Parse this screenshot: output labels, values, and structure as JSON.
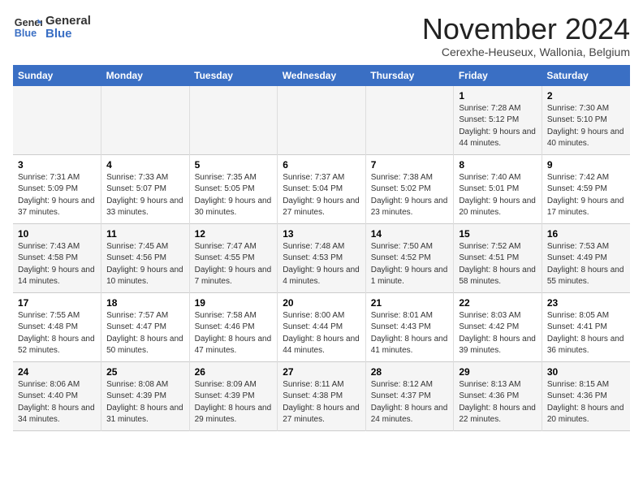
{
  "logo": {
    "line1": "General",
    "line2": "Blue"
  },
  "title": "November 2024",
  "subtitle": "Cerexhe-Heuseux, Wallonia, Belgium",
  "headers": [
    "Sunday",
    "Monday",
    "Tuesday",
    "Wednesday",
    "Thursday",
    "Friday",
    "Saturday"
  ],
  "weeks": [
    [
      {
        "day": "",
        "info": ""
      },
      {
        "day": "",
        "info": ""
      },
      {
        "day": "",
        "info": ""
      },
      {
        "day": "",
        "info": ""
      },
      {
        "day": "",
        "info": ""
      },
      {
        "day": "1",
        "info": "Sunrise: 7:28 AM\nSunset: 5:12 PM\nDaylight: 9 hours and 44 minutes."
      },
      {
        "day": "2",
        "info": "Sunrise: 7:30 AM\nSunset: 5:10 PM\nDaylight: 9 hours and 40 minutes."
      }
    ],
    [
      {
        "day": "3",
        "info": "Sunrise: 7:31 AM\nSunset: 5:09 PM\nDaylight: 9 hours and 37 minutes."
      },
      {
        "day": "4",
        "info": "Sunrise: 7:33 AM\nSunset: 5:07 PM\nDaylight: 9 hours and 33 minutes."
      },
      {
        "day": "5",
        "info": "Sunrise: 7:35 AM\nSunset: 5:05 PM\nDaylight: 9 hours and 30 minutes."
      },
      {
        "day": "6",
        "info": "Sunrise: 7:37 AM\nSunset: 5:04 PM\nDaylight: 9 hours and 27 minutes."
      },
      {
        "day": "7",
        "info": "Sunrise: 7:38 AM\nSunset: 5:02 PM\nDaylight: 9 hours and 23 minutes."
      },
      {
        "day": "8",
        "info": "Sunrise: 7:40 AM\nSunset: 5:01 PM\nDaylight: 9 hours and 20 minutes."
      },
      {
        "day": "9",
        "info": "Sunrise: 7:42 AM\nSunset: 4:59 PM\nDaylight: 9 hours and 17 minutes."
      }
    ],
    [
      {
        "day": "10",
        "info": "Sunrise: 7:43 AM\nSunset: 4:58 PM\nDaylight: 9 hours and 14 minutes."
      },
      {
        "day": "11",
        "info": "Sunrise: 7:45 AM\nSunset: 4:56 PM\nDaylight: 9 hours and 10 minutes."
      },
      {
        "day": "12",
        "info": "Sunrise: 7:47 AM\nSunset: 4:55 PM\nDaylight: 9 hours and 7 minutes."
      },
      {
        "day": "13",
        "info": "Sunrise: 7:48 AM\nSunset: 4:53 PM\nDaylight: 9 hours and 4 minutes."
      },
      {
        "day": "14",
        "info": "Sunrise: 7:50 AM\nSunset: 4:52 PM\nDaylight: 9 hours and 1 minute."
      },
      {
        "day": "15",
        "info": "Sunrise: 7:52 AM\nSunset: 4:51 PM\nDaylight: 8 hours and 58 minutes."
      },
      {
        "day": "16",
        "info": "Sunrise: 7:53 AM\nSunset: 4:49 PM\nDaylight: 8 hours and 55 minutes."
      }
    ],
    [
      {
        "day": "17",
        "info": "Sunrise: 7:55 AM\nSunset: 4:48 PM\nDaylight: 8 hours and 52 minutes."
      },
      {
        "day": "18",
        "info": "Sunrise: 7:57 AM\nSunset: 4:47 PM\nDaylight: 8 hours and 50 minutes."
      },
      {
        "day": "19",
        "info": "Sunrise: 7:58 AM\nSunset: 4:46 PM\nDaylight: 8 hours and 47 minutes."
      },
      {
        "day": "20",
        "info": "Sunrise: 8:00 AM\nSunset: 4:44 PM\nDaylight: 8 hours and 44 minutes."
      },
      {
        "day": "21",
        "info": "Sunrise: 8:01 AM\nSunset: 4:43 PM\nDaylight: 8 hours and 41 minutes."
      },
      {
        "day": "22",
        "info": "Sunrise: 8:03 AM\nSunset: 4:42 PM\nDaylight: 8 hours and 39 minutes."
      },
      {
        "day": "23",
        "info": "Sunrise: 8:05 AM\nSunset: 4:41 PM\nDaylight: 8 hours and 36 minutes."
      }
    ],
    [
      {
        "day": "24",
        "info": "Sunrise: 8:06 AM\nSunset: 4:40 PM\nDaylight: 8 hours and 34 minutes."
      },
      {
        "day": "25",
        "info": "Sunrise: 8:08 AM\nSunset: 4:39 PM\nDaylight: 8 hours and 31 minutes."
      },
      {
        "day": "26",
        "info": "Sunrise: 8:09 AM\nSunset: 4:39 PM\nDaylight: 8 hours and 29 minutes."
      },
      {
        "day": "27",
        "info": "Sunrise: 8:11 AM\nSunset: 4:38 PM\nDaylight: 8 hours and 27 minutes."
      },
      {
        "day": "28",
        "info": "Sunrise: 8:12 AM\nSunset: 4:37 PM\nDaylight: 8 hours and 24 minutes."
      },
      {
        "day": "29",
        "info": "Sunrise: 8:13 AM\nSunset: 4:36 PM\nDaylight: 8 hours and 22 minutes."
      },
      {
        "day": "30",
        "info": "Sunrise: 8:15 AM\nSunset: 4:36 PM\nDaylight: 8 hours and 20 minutes."
      }
    ]
  ]
}
